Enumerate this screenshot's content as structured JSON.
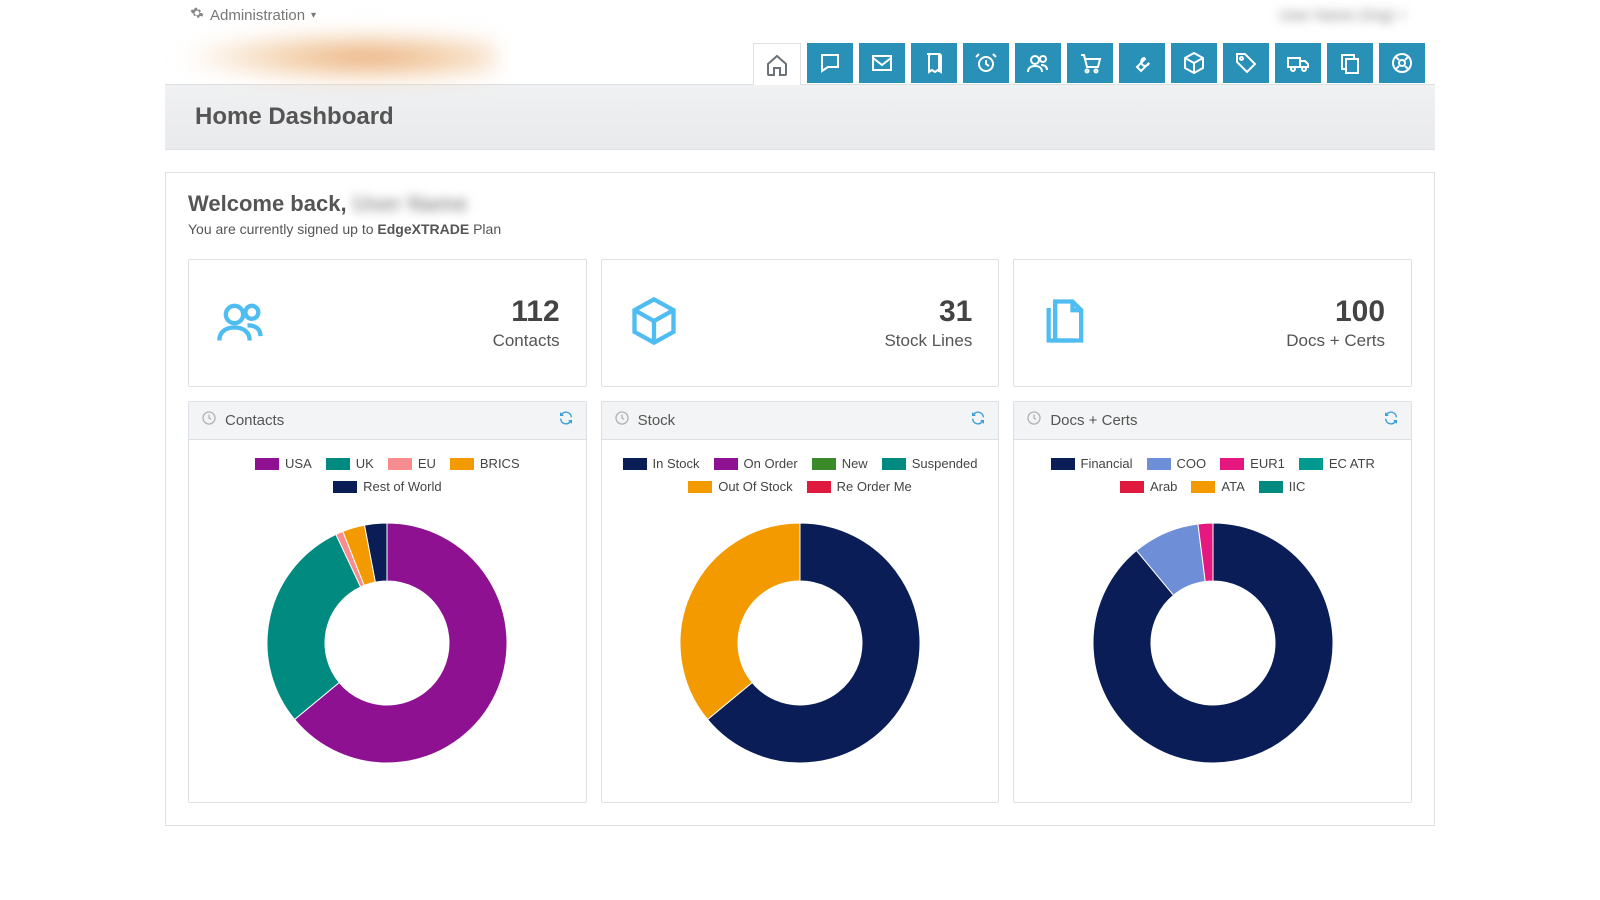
{
  "admin_menu": "Administration",
  "user_menu_blurred": "User Name (Org)",
  "page_title": "Home Dashboard",
  "welcome_prefix": "Welcome back,",
  "welcome_name_blurred": "User Name",
  "plan_prefix": "You are currently signed up to",
  "plan_name": "EdgeXTRADE",
  "plan_suffix": "Plan",
  "nav_icons": [
    "home",
    "chat",
    "mail",
    "book",
    "alarm",
    "contacts",
    "cart",
    "wrench",
    "package",
    "tag",
    "truck",
    "copy",
    "help"
  ],
  "tiles": [
    {
      "icon": "contacts",
      "value": "112",
      "label": "Contacts"
    },
    {
      "icon": "package",
      "value": "31",
      "label": "Stock Lines"
    },
    {
      "icon": "docs",
      "value": "100",
      "label": "Docs + Certs"
    }
  ],
  "panels": [
    {
      "id": "contacts",
      "title": "Contacts"
    },
    {
      "id": "stock",
      "title": "Stock"
    },
    {
      "id": "docs",
      "title": "Docs + Certs"
    }
  ],
  "colors": {
    "navy": "#0a1d56",
    "purple": "#8e1191",
    "teal": "#008a80",
    "salmon": "#f98c8c",
    "orange": "#f29a00",
    "green": "#3a8a2a",
    "red": "#e01a3f",
    "blue": "#6f8ed8",
    "magenta": "#e6177e",
    "teal2": "#009a8e"
  },
  "chart_data": [
    {
      "id": "contacts",
      "type": "donut",
      "title": "Contacts",
      "series": [
        {
          "name": "USA",
          "value": 64,
          "color": "purple"
        },
        {
          "name": "UK",
          "value": 29,
          "color": "teal"
        },
        {
          "name": "EU",
          "value": 1,
          "color": "salmon"
        },
        {
          "name": "BRICS",
          "value": 3,
          "color": "orange"
        },
        {
          "name": "Rest of World",
          "value": 3,
          "color": "navy"
        }
      ]
    },
    {
      "id": "stock",
      "type": "donut",
      "title": "Stock",
      "series": [
        {
          "name": "In Stock",
          "value": 64,
          "color": "navy"
        },
        {
          "name": "On Order",
          "value": 0,
          "color": "purple"
        },
        {
          "name": "New",
          "value": 0,
          "color": "green"
        },
        {
          "name": "Suspended",
          "value": 0,
          "color": "teal"
        },
        {
          "name": "Out Of Stock",
          "value": 36,
          "color": "orange"
        },
        {
          "name": "Re Order Me",
          "value": 0,
          "color": "red"
        }
      ]
    },
    {
      "id": "docs",
      "type": "donut",
      "title": "Docs + Certs",
      "series": [
        {
          "name": "Financial",
          "value": 89,
          "color": "navy"
        },
        {
          "name": "COO",
          "value": 9,
          "color": "blue"
        },
        {
          "name": "EUR1",
          "value": 2,
          "color": "magenta"
        },
        {
          "name": "EC ATR",
          "value": 0,
          "color": "teal2"
        },
        {
          "name": "Arab",
          "value": 0,
          "color": "red"
        },
        {
          "name": "ATA",
          "value": 0,
          "color": "orange"
        },
        {
          "name": "IIC",
          "value": 0,
          "color": "teal"
        }
      ]
    }
  ]
}
